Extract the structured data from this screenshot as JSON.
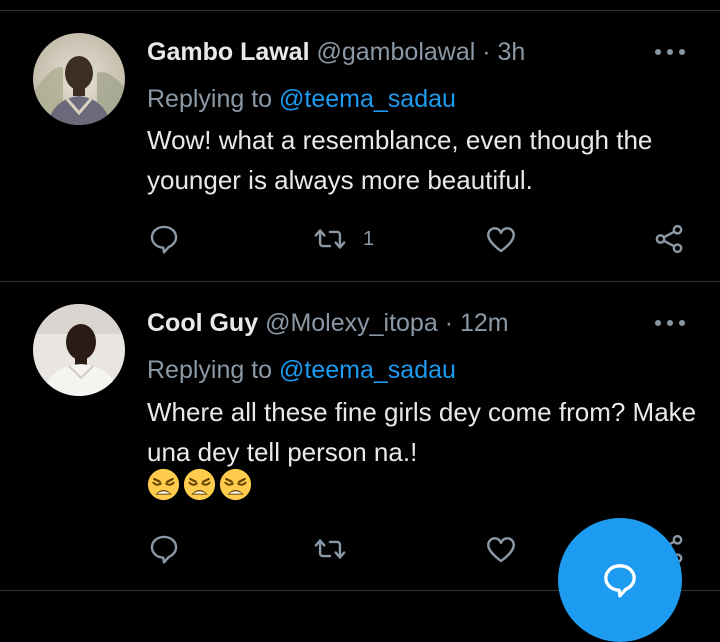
{
  "tweets": [
    {
      "name": "Gambo Lawal",
      "handle": "@gambolawal",
      "separator": "·",
      "time": "3h",
      "replying_prefix": "Replying to",
      "replying_to": "@teema_sadau",
      "text": "Wow! what a resemblance, even though the younger is always more beautiful.",
      "emojis": [],
      "actions": {
        "reply_icon": "comment-icon",
        "retweet_icon": "retweet-icon",
        "retweet_count": "1",
        "like_icon": "heart-icon",
        "share_icon": "share-icon"
      }
    },
    {
      "name": "Cool Guy",
      "handle": "@Molexy_itopa",
      "separator": "·",
      "time": "12m",
      "replying_prefix": "Replying to",
      "replying_to": "@teema_sadau",
      "text": "Where all these fine girls dey come from? Make una dey tell person na.!",
      "emojis": [
        "weary-face",
        "weary-face",
        "weary-face"
      ],
      "actions": {
        "reply_icon": "comment-icon",
        "retweet_icon": "retweet-icon",
        "retweet_count": "",
        "like_icon": "heart-icon",
        "share_icon": "share-icon"
      }
    }
  ],
  "fab": {
    "icon": "compose-reply-icon"
  },
  "colors": {
    "background": "#000000",
    "accent": "#1d9bf0",
    "muted_text": "#8b98a5",
    "divider": "#2f3336"
  }
}
